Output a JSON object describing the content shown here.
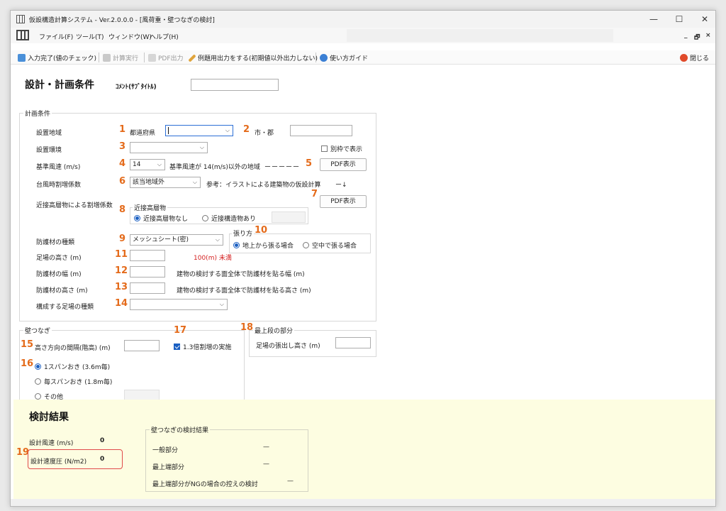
{
  "window": {
    "title": "仮設構造計算システム - Ver.2.0.0.0 - [風荷重・壁つなぎの検討]",
    "minimize": "—",
    "maximize": "☐",
    "close": "✕"
  },
  "menu": {
    "items": [
      "ファイル(F)",
      "ツール(T)",
      "ウィンドウ(W)",
      "ヘルプ(H)"
    ],
    "mdi_min": "_",
    "mdi_restore": "🗗",
    "mdi_close": "×"
  },
  "toolbar": {
    "input_done": "入力完了(値のチェック)",
    "calc": "計算実行",
    "pdf": "PDF出力",
    "example": "例題用出力をする(初期値以外出力しない)",
    "guide": "使い方ガイド",
    "close": "閉じる"
  },
  "conditions": {
    "heading": "設計・計画条件",
    "comment_label": "ｺﾒﾝﾄ(ｻﾌﾞﾀｲﾄﾙ)",
    "comment_value": "",
    "plan_group": "計画条件",
    "labels": {
      "area": "設置地域",
      "env": "設置環境",
      "wind": "基準風速 (m/s)",
      "typhoon": "台風時割増係数",
      "nearby": "近接高層物による割増係数",
      "material": "防護材の種類",
      "height": "足場の高さ (m)",
      "mat_width": "防護材の幅 (m)",
      "mat_height": "防護材の高さ (m)",
      "scaffold_type": "構成する足場の種類"
    },
    "pref_label": "都道府県",
    "city_label": "市・郡",
    "pref_value": "",
    "city_value": "",
    "env_value": "",
    "separate_window": "別枠で表示",
    "wind_value": "14",
    "wind_note": "基準風速が 14(m/s)以外の地域",
    "dashes": "ーーーーー",
    "pdf_button": "PDF表示",
    "typhoon_value": "該当地域外",
    "typhoon_note": "参考：イラストによる建築物の仮設計算",
    "typhoon_arrow": "ー↓",
    "pdf_button2": "PDF表示",
    "nearby_group": "近接高層物",
    "nearby_opt1": "近接高層物なし",
    "nearby_opt2": "近接構造物あり",
    "material_value": "メッシュシート(密)",
    "tension_group": "張り方",
    "tension_opt1": "地上から張る場合",
    "tension_opt2": "空中で張る場合",
    "height_value": "",
    "height_note": "100(m) 未満",
    "mat_width_value": "",
    "mat_width_note": "建物の検討する面全体で防護材を貼る幅 (m)",
    "mat_height_value": "",
    "mat_height_note": "建物の検討する面全体で防護材を貼る高さ (m)",
    "scaffold_value": ""
  },
  "wall_ties": {
    "group": "壁つなぎ",
    "interval_label": "高さ方向の間隔(階高) (m)",
    "interval_value": "",
    "opt1": "1スパンおき (3.6m毎)",
    "opt2": "毎スパンおき (1.8m毎)",
    "opt3": "その他",
    "other_value": "",
    "check_label": "1.3倍割増の実施",
    "top_group": "最上段の部分",
    "top_label": "足場の張出し高さ (m)",
    "top_value": ""
  },
  "numbers": [
    "1",
    "2",
    "3",
    "4",
    "5",
    "6",
    "7",
    "8",
    "9",
    "10",
    "11",
    "12",
    "13",
    "14",
    "15",
    "16",
    "17",
    "18",
    "19"
  ],
  "results": {
    "heading": "検討結果",
    "wind_label": "設計風速 (m/s)",
    "wind_value": "0",
    "pressure_label": "設計速度圧 (N/m2)",
    "pressure_value": "0",
    "tie_group": "壁つなぎの検討結果",
    "general": "一般部分",
    "general_value": "—",
    "top": "最上端部分",
    "top_value": "—",
    "top_ng": "最上端部分がNGの場合の控えの検討",
    "top_ng_value": "—"
  },
  "colors": {
    "accent": "#e46b1b",
    "results_bg": "#fdfde1",
    "warning": "#d42020",
    "highlight": "#e04a4a"
  }
}
